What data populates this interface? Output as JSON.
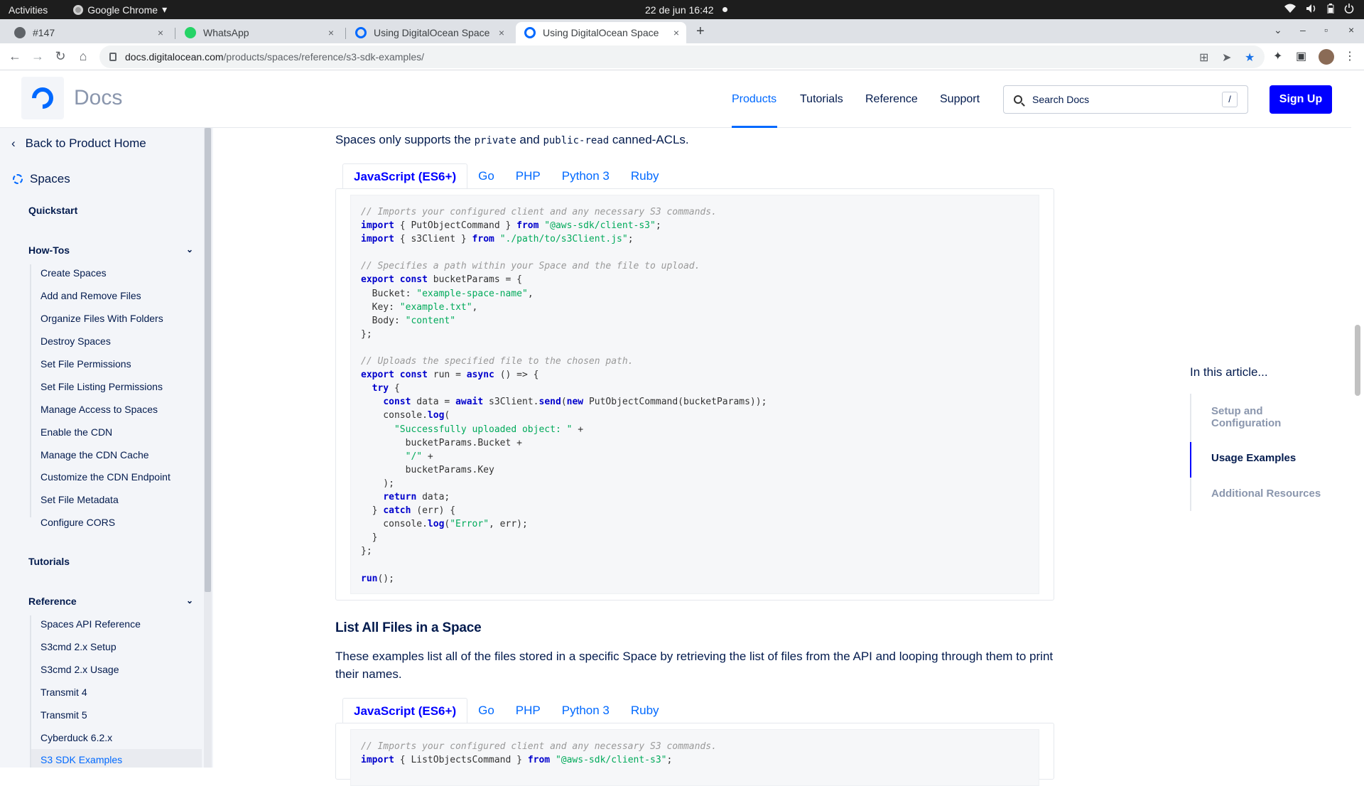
{
  "os": {
    "activities": "Activities",
    "app_name": "Google Chrome",
    "app_caret": "▾",
    "clock": "22 de jun  16:42"
  },
  "tabs": [
    {
      "title": "#147",
      "close": "×"
    },
    {
      "title": "WhatsApp",
      "close": "×"
    },
    {
      "title": "Using DigitalOcean Space",
      "close": "×"
    },
    {
      "title": "Using DigitalOcean Space",
      "close": "×"
    }
  ],
  "new_tab": "+",
  "window_controls": {
    "min": "–",
    "max": "▫",
    "close": "×"
  },
  "address": {
    "host": "docs.digitalocean.com",
    "path": "/products/spaces/reference/s3-sdk-examples/"
  },
  "header": {
    "docs_title": "Docs",
    "nav": [
      "Products",
      "Tutorials",
      "Reference",
      "Support"
    ],
    "search_placeholder": "Search Docs",
    "search_shortcut": "/",
    "signup": "Sign Up"
  },
  "sidebar": {
    "back": "Back to Product Home",
    "product": "Spaces",
    "quickstart": "Quickstart",
    "howtos_heading": "How-Tos",
    "howtos": [
      "Create Spaces",
      "Add and Remove Files",
      "Organize Files With Folders",
      "Destroy Spaces",
      "Set File Permissions",
      "Set File Listing Permissions",
      "Manage Access to Spaces",
      "Enable the CDN",
      "Manage the CDN Cache",
      "Customize the CDN Endpoint",
      "Set File Metadata",
      "Configure CORS"
    ],
    "tutorials_heading": "Tutorials",
    "reference_heading": "Reference",
    "reference": [
      "Spaces API Reference",
      "S3cmd 2.x Setup",
      "S3cmd 2.x Usage",
      "Transmit 4",
      "Transmit 5",
      "Cyberduck 6.2.x",
      "S3 SDK Examples"
    ]
  },
  "content": {
    "intro_a": "Spaces only supports the ",
    "intro_code1": "private",
    "intro_b": " and ",
    "intro_code2": "public-read",
    "intro_c": " canned-ACLs.",
    "lang_tabs": [
      "JavaScript (ES6+)",
      "Go",
      "PHP",
      "Python 3",
      "Ruby"
    ],
    "section_heading": "List All Files in a Space",
    "section_para": "These examples list all of the files stored in a specific Space by retrieving the list of files from the API and looping through them to print their names.",
    "second_code_line1": "// Imports your configured client and any necessary S3 commands.",
    "second_code_line2_kw1": "import",
    "second_code_line2_mid": " { ListObjectsCommand } ",
    "second_code_line2_kw2": "from",
    "second_code_line2_str": "\"@aws-sdk/client-s3\"",
    "second_code_line2_end": ";"
  },
  "toc": {
    "title": "In this article...",
    "items": [
      "Setup and Configuration",
      "Usage Examples",
      "Additional Resources"
    ]
  },
  "colors": {
    "brand": "#0069ff",
    "signup": "#0000ff",
    "text": "#031b4e"
  }
}
